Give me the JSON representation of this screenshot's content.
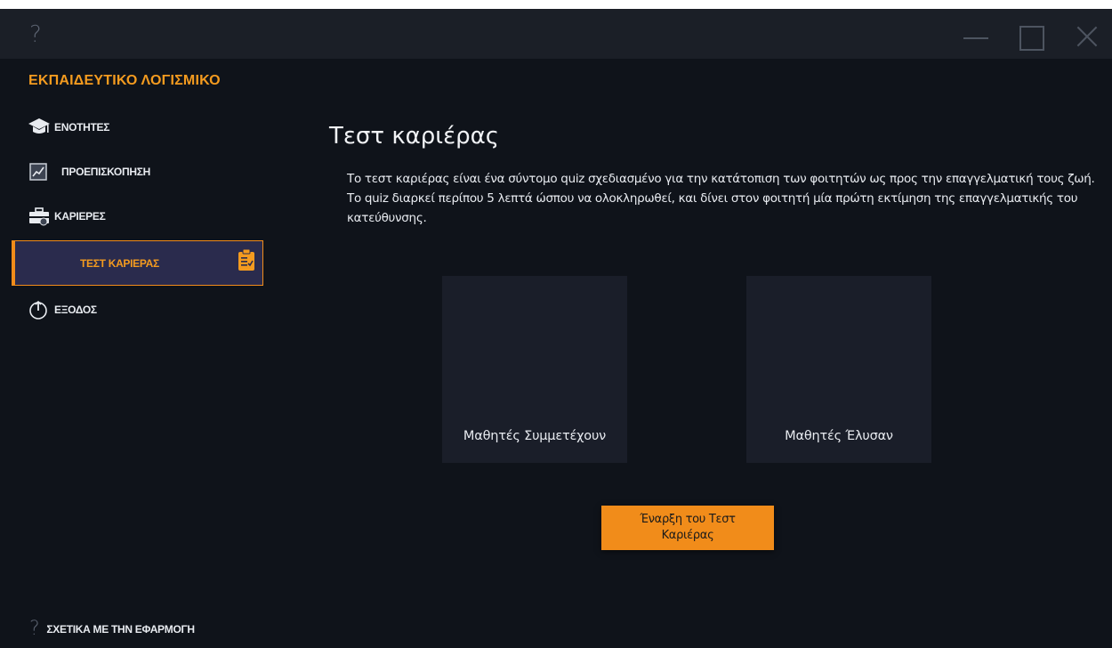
{
  "titlebar": {
    "help_glyph": "?"
  },
  "app": {
    "title": "ΕΚΠΑΙΔΕΥΤΙΚΟ ΛΟΓΙΣΜΙΚΟ"
  },
  "sidebar": {
    "items": [
      {
        "label": "ΕΝΟΤΗΤΕΣ",
        "icon": "graduation-cap-icon"
      },
      {
        "label": "ΠΡΟΕΠΙΣΚΟΠΗΣΗ",
        "icon": "chart-icon"
      },
      {
        "label": "ΚΑΡΙΕΡΕΣ",
        "icon": "briefcase-icon"
      },
      {
        "label": "ΤΕΣΤ ΚΑΡΙΕΡΑΣ",
        "icon": "clipboard-icon",
        "active": true
      },
      {
        "label": "ΕΞΟΔΟΣ",
        "icon": "power-icon"
      }
    ],
    "about": {
      "glyph": "?",
      "label": "ΣΧΕΤΙΚΑ ΜΕ ΤΗΝ ΕΦΑΡΜΟΓΗ"
    }
  },
  "main": {
    "title": "Τεστ καριέρας",
    "description": "Το τεστ καριέρας είναι ένα σύντομο quiz σχεδιασμένο για την κατάτοπιση των φοιτητών ως προς την επαγγελματική τους ζωή. Το quiz διαρκεί περίπου 5 λεπτά ώσπου να ολοκληρωθεί, και δίνει στον φοιτητή μία πρώτη εκτίμηση της επαγγελματικής του κατεύθυνσης.",
    "cards": [
      {
        "label": "Μαθητές Συμμετέχουν"
      },
      {
        "label": "Μαθητές Έλυσαν"
      }
    ],
    "start_button": "Έναρξη του Τεστ Καριέρας"
  },
  "colors": {
    "accent": "#f18c1a",
    "background": "#0f131a",
    "titlebar": "#1b1f27",
    "card": "#1a1e29",
    "active_item": "#2a2b4d"
  }
}
